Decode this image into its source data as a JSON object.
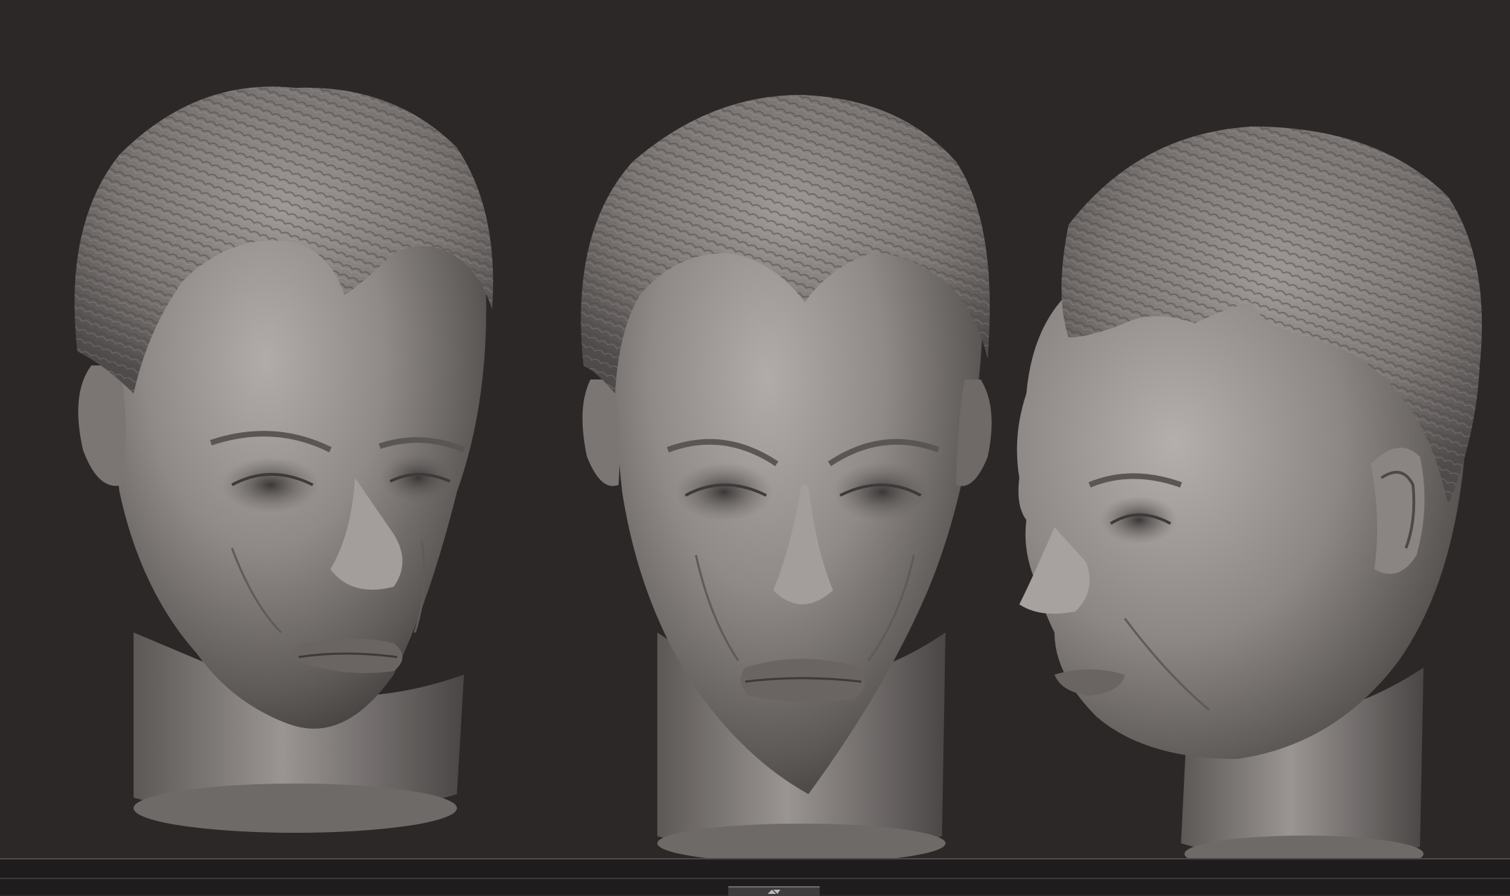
{
  "viewport": {
    "background": "#2b2827",
    "models": [
      {
        "name": "head-three-quarter-left",
        "material": "#8a8583"
      },
      {
        "name": "head-front",
        "material": "#8a8583"
      },
      {
        "name": "head-profile-right",
        "material": "#8a8583"
      }
    ]
  },
  "statusbar": {
    "background": "#1e1c1c",
    "handle_icon": "drag-grip-icon"
  }
}
